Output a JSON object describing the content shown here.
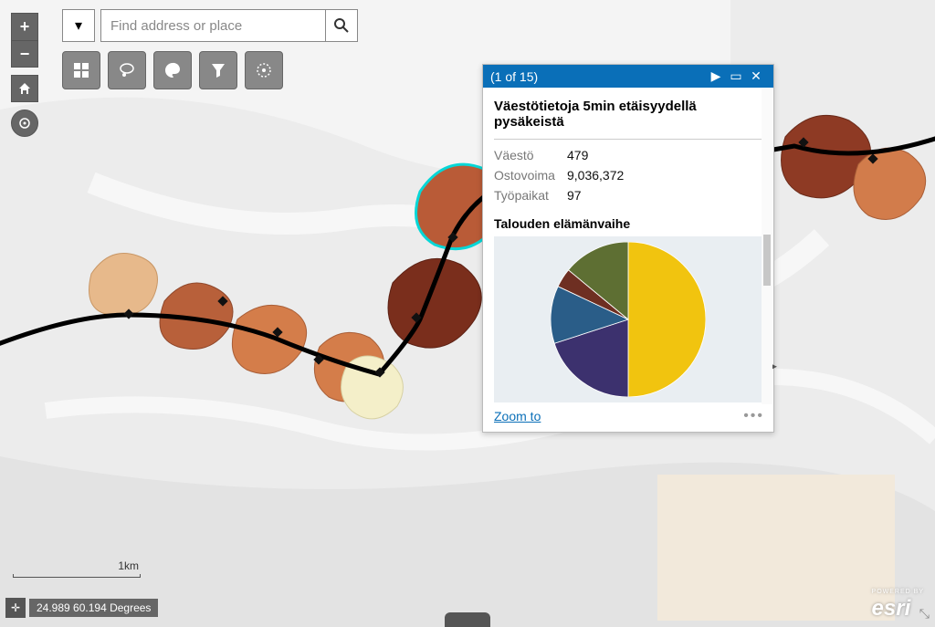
{
  "search": {
    "placeholder": "Find address or place"
  },
  "popup": {
    "pager": "(1 of 15)",
    "title": "Väestötietoja 5min etäisyydellä pysäkeistä",
    "fields": {
      "vaesto_label": "Väestö",
      "vaesto_value": "479",
      "ostovoima_label": "Ostovoima",
      "ostovoima_value": "9,036,372",
      "tyopaikat_label": "Työpaikat",
      "tyopaikat_value": "97"
    },
    "pie_title": "Talouden elämänvaihe",
    "zoom_to": "Zoom to"
  },
  "scalebar": {
    "label": "1km"
  },
  "coords": {
    "text": "24.989 60.194 Degrees"
  },
  "attribution": {
    "powered_by": "POWERED BY",
    "brand": "esri"
  },
  "chart_data": {
    "type": "pie",
    "title": "Talouden elämänvaihe",
    "series": [
      {
        "name": "slice-yellow",
        "value": 50,
        "color": "#f1c40f"
      },
      {
        "name": "slice-purple",
        "value": 20,
        "color": "#3c316e"
      },
      {
        "name": "slice-blue",
        "value": 12,
        "color": "#2a5d88"
      },
      {
        "name": "slice-brown",
        "value": 4,
        "color": "#6e2f22"
      },
      {
        "name": "slice-olive",
        "value": 14,
        "color": "#5e6f33"
      }
    ]
  },
  "map_overlay": {
    "selected_cluster_color": "#06d7d7",
    "route_color": "#000000",
    "clusters": [
      {
        "color": "#e7b98b"
      },
      {
        "color": "#b8603a"
      },
      {
        "color": "#d47d4a"
      },
      {
        "color": "#7a2e1c"
      },
      {
        "color": "#f4efc9"
      },
      {
        "color": "#b95b37"
      },
      {
        "color": "#8e3a24"
      },
      {
        "color": "#d27c4b"
      }
    ]
  }
}
